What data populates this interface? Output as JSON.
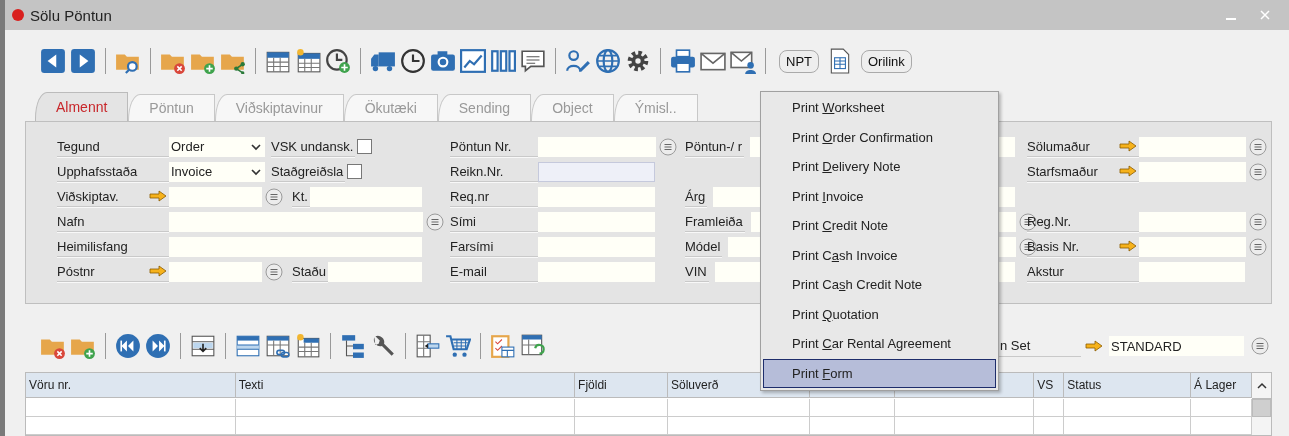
{
  "window": {
    "title": "Sölu Pöntun"
  },
  "toolbar": {
    "buttons": [
      "NPT",
      "Orilink"
    ]
  },
  "tabs": [
    {
      "label": "Almennt",
      "selected": true
    },
    {
      "label": "Pöntun",
      "selected": false
    },
    {
      "label": "Viðskiptavinur",
      "selected": false
    },
    {
      "label": "Ökutæki",
      "selected": false
    },
    {
      "label": "Sending",
      "selected": false
    },
    {
      "label": "Object",
      "selected": false
    },
    {
      "label": "Ýmisl..",
      "selected": false
    }
  ],
  "form": {
    "sections": [
      {
        "rows": [
          {
            "items": [
              {
                "kind": "label",
                "text": "Tegund"
              },
              {
                "kind": "select",
                "value": "Order"
              },
              {
                "kind": "label",
                "text": "VSK undansk."
              },
              {
                "kind": "checkbox",
                "checked": false
              }
            ]
          },
          {
            "items": [
              {
                "kind": "label",
                "text": "Upphafsstaða"
              },
              {
                "kind": "select",
                "value": "Invoice"
              },
              {
                "kind": "label",
                "text": "Staðgreiðsla"
              },
              {
                "kind": "checkbox",
                "checked": false
              }
            ]
          },
          {
            "items": [
              {
                "kind": "label",
                "text": "Viðskiptav.",
                "arrow": true
              },
              {
                "kind": "field"
              },
              {
                "kind": "lookup"
              },
              {
                "kind": "label",
                "text": "Kt."
              },
              {
                "kind": "field"
              }
            ]
          },
          {
            "items": [
              {
                "kind": "label",
                "text": "Nafn"
              },
              {
                "kind": "field"
              },
              {
                "kind": "lookup"
              }
            ]
          },
          {
            "items": [
              {
                "kind": "label",
                "text": "Heimilisfang"
              },
              {
                "kind": "field"
              }
            ]
          },
          {
            "items": [
              {
                "kind": "label",
                "text": "Póstnr",
                "arrow": true
              },
              {
                "kind": "field"
              },
              {
                "kind": "lookup"
              },
              {
                "kind": "label",
                "text": "Staðu"
              },
              {
                "kind": "field"
              }
            ]
          }
        ]
      },
      {
        "rows": [
          {
            "items": [
              {
                "kind": "label",
                "text": "Pöntun Nr."
              },
              {
                "kind": "field"
              },
              {
                "kind": "lookup"
              }
            ]
          },
          {
            "items": [
              {
                "kind": "label",
                "text": "Reikn.Nr."
              },
              {
                "kind": "field",
                "readonly": true
              }
            ]
          },
          {
            "items": [
              {
                "kind": "label",
                "text": "Req.nr"
              },
              {
                "kind": "field"
              }
            ]
          },
          {
            "items": [
              {
                "kind": "label",
                "text": "Sími"
              },
              {
                "kind": "field"
              }
            ]
          },
          {
            "items": [
              {
                "kind": "label",
                "text": "Farsími"
              },
              {
                "kind": "field"
              }
            ]
          },
          {
            "items": [
              {
                "kind": "label",
                "text": "E-mail"
              },
              {
                "kind": "field"
              }
            ]
          }
        ]
      },
      {
        "rows": [
          {
            "items": [
              {
                "kind": "label",
                "text": "Pöntun-/ r"
              },
              {
                "kind": "field"
              }
            ]
          },
          {},
          {
            "items": [
              {
                "kind": "label",
                "text": "Árg"
              },
              {
                "kind": "field"
              }
            ]
          },
          {
            "items": [
              {
                "kind": "label",
                "text": "Framleiða"
              },
              {
                "kind": "field"
              },
              {
                "kind": "lookup"
              }
            ]
          },
          {
            "items": [
              {
                "kind": "label",
                "text": "Módel"
              },
              {
                "kind": "field"
              },
              {
                "kind": "lookup"
              }
            ]
          },
          {
            "items": [
              {
                "kind": "label",
                "text": "VIN"
              },
              {
                "kind": "field"
              }
            ]
          }
        ]
      },
      {
        "rows": [
          {
            "items": [
              {
                "kind": "label",
                "text": "Sölumaður",
                "arrow": true
              },
              {
                "kind": "field"
              },
              {
                "kind": "lookup"
              }
            ]
          },
          {
            "items": [
              {
                "kind": "label",
                "text": "Starfsmaður",
                "arrow": true
              },
              {
                "kind": "field"
              },
              {
                "kind": "lookup"
              }
            ]
          },
          {},
          {
            "items": [
              {
                "kind": "label",
                "text": "Reg.Nr."
              },
              {
                "kind": "field"
              },
              {
                "kind": "lookup"
              }
            ]
          },
          {
            "items": [
              {
                "kind": "label",
                "text": "Basis Nr.",
                "arrow": true
              },
              {
                "kind": "field"
              },
              {
                "kind": "lookup"
              }
            ]
          },
          {
            "items": [
              {
                "kind": "label",
                "text": "Akstur"
              },
              {
                "kind": "field"
              }
            ]
          }
        ]
      }
    ]
  },
  "lines": {
    "set_label": "n Set",
    "set_value": "STANDARD",
    "columns": [
      {
        "label": "Vöru nr."
      },
      {
        "label": "Texti"
      },
      {
        "label": "Fjöldi"
      },
      {
        "label": "Söluverð"
      },
      {},
      {},
      {
        "label": "VS"
      },
      {
        "label": "Status"
      },
      {
        "label": "Á Lager"
      }
    ]
  },
  "menu": {
    "items": [
      {
        "label_before": "Print ",
        "accelerator": "W",
        "label_after": "orksheet",
        "selected": false
      },
      {
        "label_before": "Print ",
        "accelerator": "O",
        "label_after": "rder Confirmation",
        "selected": false
      },
      {
        "label_before": "Print ",
        "accelerator": "D",
        "label_after": "elivery Note",
        "selected": false
      },
      {
        "label_before": "Print ",
        "accelerator": "I",
        "label_after": "nvoice",
        "selected": false
      },
      {
        "label_before": "Print ",
        "accelerator": "C",
        "label_after": "redit Note",
        "selected": false
      },
      {
        "label_before": "Print C",
        "accelerator": "a",
        "label_after": "sh Invoice",
        "selected": false
      },
      {
        "label_before": "Print Ca",
        "accelerator": "s",
        "label_after": "h Credit Note",
        "selected": false
      },
      {
        "label_before": "Print ",
        "accelerator": "Q",
        "label_after": "uotation",
        "selected": false
      },
      {
        "label_before": "Print ",
        "accelerator": "C",
        "label_after": "ar Rental Agreement",
        "selected": false
      },
      {
        "label_before": "Print ",
        "accelerator": "F",
        "label_after": "orm",
        "selected": true
      }
    ]
  }
}
